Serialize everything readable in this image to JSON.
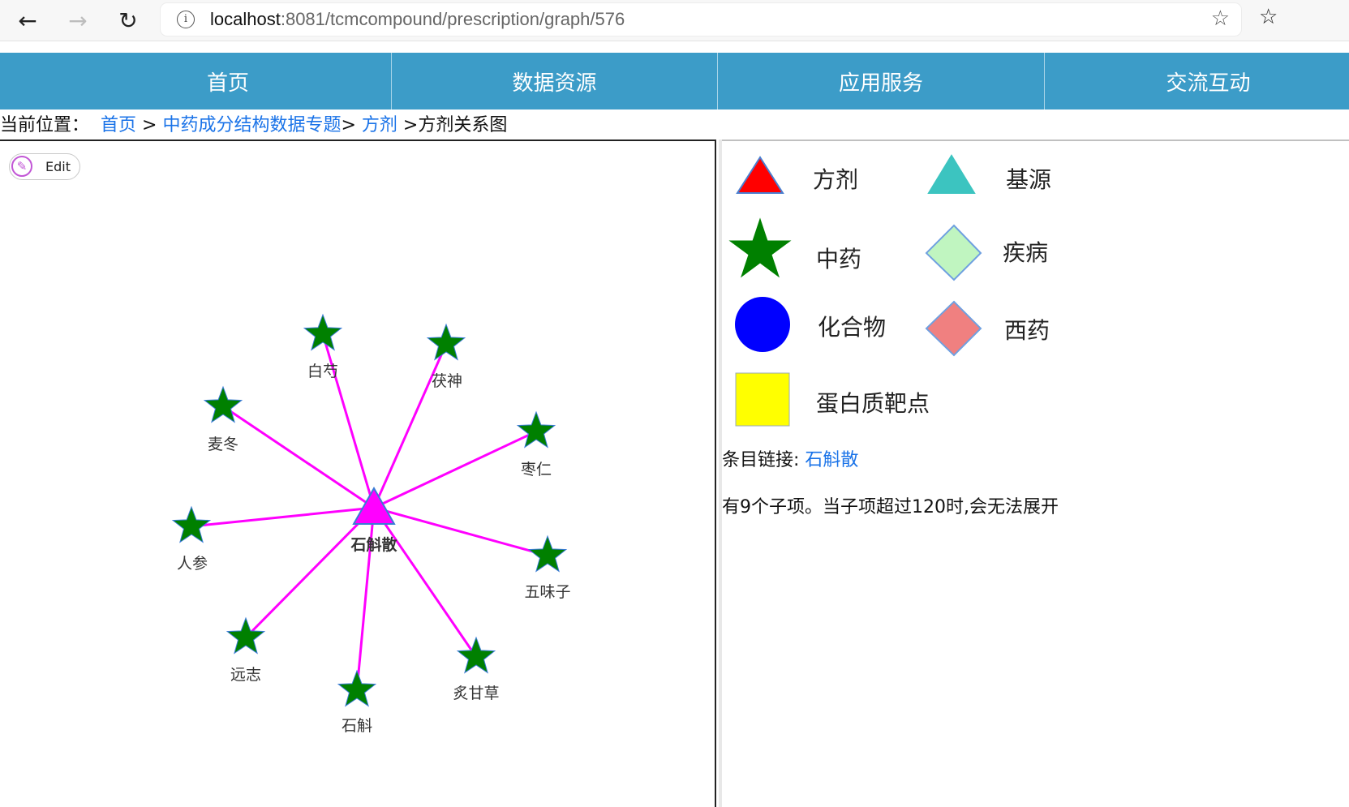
{
  "browser": {
    "url_host": "localhost",
    "url_rest": ":8081/tcmcompound/prescription/graph/576",
    "back_icon": "back-arrow-icon",
    "forward_icon": "forward-arrow-icon",
    "reload_icon": "reload-icon",
    "info_icon": "info-icon",
    "favorite_icon": "star-outline-icon"
  },
  "menu": {
    "items": [
      {
        "label": "首页"
      },
      {
        "label": "数据资源"
      },
      {
        "label": "应用服务"
      },
      {
        "label": "交流互动"
      }
    ],
    "background": "#3c9cc8"
  },
  "breadcrumb": {
    "prefix": "当前位置：",
    "items": [
      {
        "label": "首页",
        "link": true
      },
      {
        "label": "中药成分结构数据专题",
        "link": true
      },
      {
        "label": "方剂",
        "link": true
      },
      {
        "label": "方剂关系图",
        "link": false
      }
    ]
  },
  "graph": {
    "edit_label": "Edit",
    "edit_icon": "pencil-icon",
    "center": {
      "label": "石斛散",
      "shape": "triangle",
      "color": "#ff00ff"
    },
    "edge_color": "#ff00ff",
    "node_color": "#008000",
    "children": [
      {
        "label": "白芍"
      },
      {
        "label": "茯神"
      },
      {
        "label": "麦冬"
      },
      {
        "label": "枣仁"
      },
      {
        "label": "人参"
      },
      {
        "label": "五味子"
      },
      {
        "label": "远志"
      },
      {
        "label": "炙甘草"
      },
      {
        "label": "石斛"
      }
    ]
  },
  "legend": {
    "items": [
      {
        "label": "方剂",
        "shape": "triangle",
        "color": "#ff0000"
      },
      {
        "label": "基源",
        "shape": "triangle",
        "color": "#3cc4c0"
      },
      {
        "label": "中药",
        "shape": "star",
        "color": "#008000"
      },
      {
        "label": "疾病",
        "shape": "diamond",
        "color": "#c0f5c0"
      },
      {
        "label": "化合物",
        "shape": "circle",
        "color": "#0000ff"
      },
      {
        "label": "西药",
        "shape": "diamond",
        "color": "#f08080"
      },
      {
        "label": "蛋白质靶点",
        "shape": "square",
        "color": "#ffff00"
      }
    ]
  },
  "entry": {
    "prefix": "条目链接: ",
    "link_label": "石斛散"
  },
  "child_info": "有9个子项。当子项超过120时,会无法展开"
}
